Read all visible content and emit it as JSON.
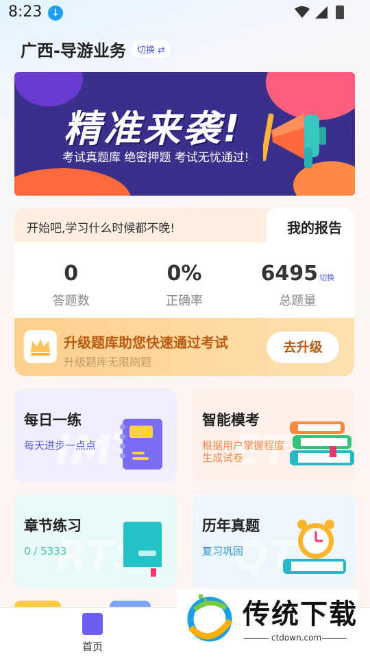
{
  "status_bar": {
    "time": "8:23"
  },
  "header": {
    "region": "广西-导游业务",
    "switch_label": "切换 ⇄"
  },
  "banner": {
    "headline": "精准来袭!",
    "subtitle": "考试真题库  绝密押题  考试无忧通过!"
  },
  "report": {
    "motto": "开始吧,学习什么时候都不晚!",
    "title": "我的报告",
    "stats": [
      {
        "value": "0",
        "label": "答题数"
      },
      {
        "value": "0%",
        "label": "正确率"
      },
      {
        "value": "6495",
        "label": "总题量",
        "switch": "切换"
      }
    ],
    "upgrade": {
      "title": "升级题库助您快速通过考试",
      "subtitle": "升级题库无限刷题",
      "button": "去升级"
    }
  },
  "features": [
    {
      "title": "每日一练",
      "subtitle": "每天进步一点点",
      "watermark": "IMT",
      "accent": "#5a63d8"
    },
    {
      "title": "智能模考",
      "subtitle": "根据用户掌握程度\n生成试卷",
      "watermark": "ETC",
      "accent": "#f08a4b"
    },
    {
      "title": "章节练习",
      "subtitle": "0 / 5333",
      "watermark": "RTS",
      "accent": "#3cbfb0"
    },
    {
      "title": "历年真题",
      "subtitle": "复习巩固",
      "watermark": "QT",
      "accent": "#2e8ccf"
    }
  ],
  "bottom_nav": {
    "home": "首页"
  },
  "logo": {
    "name": "传统下载",
    "url": "ctdown.com"
  }
}
